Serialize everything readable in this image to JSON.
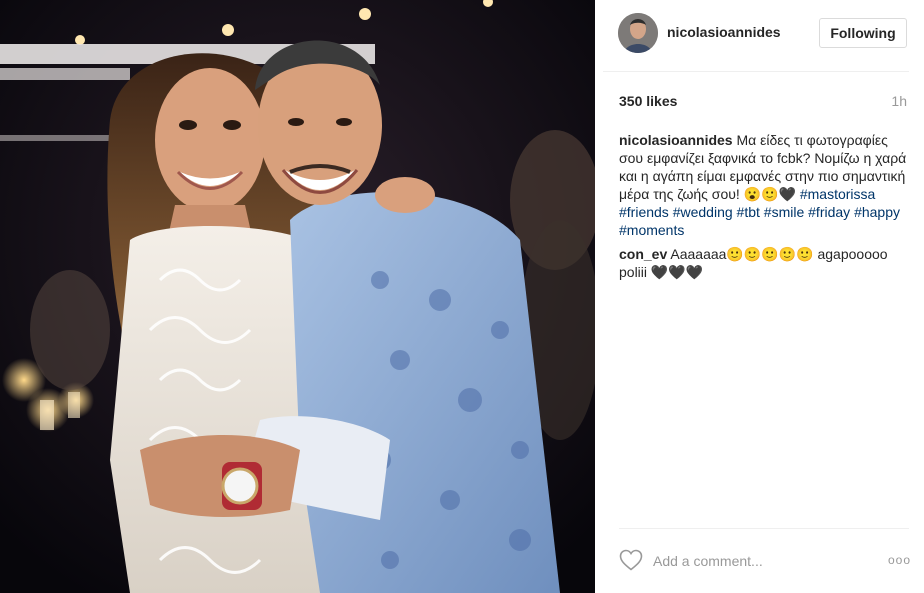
{
  "post": {
    "username": "nicolasioannides",
    "follow_label": "Following",
    "likes": "350 likes",
    "time": "1h"
  },
  "caption": {
    "author": "nicolasioannides",
    "text": "Μα είδες τι φωτογραφίες σου εμφανίζει ξαφνικά το fcbk? Νομίζω η χαρά και η αγάπη είμαι εμφανές στην πιο σημαντική μέρα της ζωής σου! 😮🙂🖤",
    "hashtags": [
      "#mastorissa",
      "#friends",
      "#wedding",
      "#tbt",
      "#smile",
      "#friday",
      "#happy",
      "#moments"
    ]
  },
  "comments": [
    {
      "author": "con_ev",
      "text": "Aaaaaaa🙂🙂🙂🙂🙂 agapooooo poliii 🖤🖤🖤"
    }
  ],
  "footer": {
    "add_comment_placeholder": "Add a comment...",
    "more_label": "ooo"
  },
  "icons": {
    "like": "heart-outline-icon",
    "more": "more-options-icon"
  },
  "colors": {
    "hashtag": "#003569",
    "muted": "#999999",
    "border": "#efefef"
  }
}
